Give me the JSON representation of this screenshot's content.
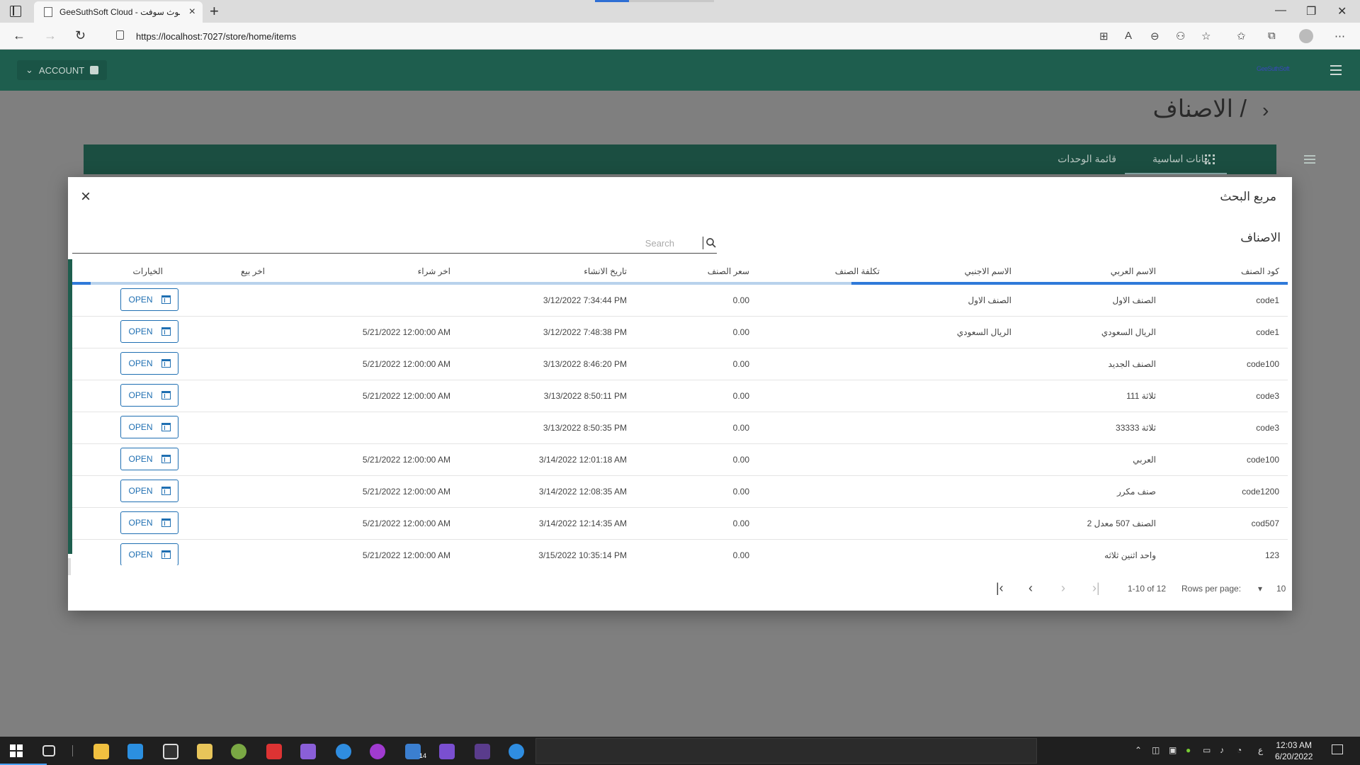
{
  "browser": {
    "tab_title": "GeeSuthSoft Cloud - جيسوث سوفت",
    "url": "https://localhost:7027/store/home/items"
  },
  "header": {
    "account_label": "ACCOUNT",
    "logo_text": "GeeSuthSoft"
  },
  "page": {
    "title": "/ الاصناف"
  },
  "tabs": [
    {
      "label": "بيانات اساسية"
    },
    {
      "label": "قائمة الوحدات"
    }
  ],
  "modal": {
    "title": "مربع البحث",
    "section_title": "الاصناف",
    "search_placeholder": "Search",
    "columns": {
      "code": "كود الصنف",
      "arabic_name": "الاسم العربي",
      "english_name": "الاسم الاجنبي",
      "cost": "تكلفة الصنف",
      "price": "سعر الصنف",
      "created": "تاريخ الانشاء",
      "last_buy": "اخر شراء",
      "last_sell": "اخر بيع",
      "options": "الخيارات"
    },
    "open_label": "OPEN",
    "rows": [
      {
        "code": "code1",
        "arabic_name": "الصنف الاول",
        "english_name": "الصنف الاول",
        "price": "0.00",
        "created": "3/12/2022 7:34:44 PM",
        "last_buy": ""
      },
      {
        "code": "code1",
        "arabic_name": "الريال السعودي",
        "english_name": "الريال السعودي",
        "price": "0.00",
        "created": "3/12/2022 7:48:38 PM",
        "last_buy": "5/21/2022 12:00:00 AM"
      },
      {
        "code": "code100",
        "arabic_name": "الصنف الجديد",
        "english_name": "",
        "price": "0.00",
        "created": "3/13/2022 8:46:20 PM",
        "last_buy": "5/21/2022 12:00:00 AM"
      },
      {
        "code": "code3",
        "arabic_name": "ثلاثة 111",
        "english_name": "",
        "price": "0.00",
        "created": "3/13/2022 8:50:11 PM",
        "last_buy": "5/21/2022 12:00:00 AM"
      },
      {
        "code": "code3",
        "arabic_name": "ثلاثة 33333",
        "english_name": "",
        "price": "0.00",
        "created": "3/13/2022 8:50:35 PM",
        "last_buy": ""
      },
      {
        "code": "code100",
        "arabic_name": "العربي",
        "english_name": "",
        "price": "0.00",
        "created": "3/14/2022 12:01:18 AM",
        "last_buy": "5/21/2022 12:00:00 AM"
      },
      {
        "code": "code1200",
        "arabic_name": "صنف مكرر",
        "english_name": "",
        "price": "0.00",
        "created": "3/14/2022 12:08:35 AM",
        "last_buy": "5/21/2022 12:00:00 AM"
      },
      {
        "code": "cod507",
        "arabic_name": "الصنف 507 معدل 2",
        "english_name": "",
        "price": "0.00",
        "created": "3/14/2022 12:14:35 AM",
        "last_buy": "5/21/2022 12:00:00 AM"
      },
      {
        "code": "123",
        "arabic_name": "واحد اثنين ثلاثه",
        "english_name": "",
        "price": "0.00",
        "created": "3/15/2022 10:35:14 PM",
        "last_buy": "5/21/2022 12:00:00 AM"
      },
      {
        "code": "",
        "arabic_name": "",
        "english_name": "",
        "price": "",
        "created": "",
        "last_buy": ""
      }
    ],
    "pager": {
      "rows_per_page_label": "Rows per page:",
      "rows_per_page_value": "10",
      "range_text": "1-10 of 12"
    }
  },
  "taskbar": {
    "time": "12:03 AM",
    "date": "6/20/2022",
    "badge": "14",
    "lang": "ع"
  },
  "colors": {
    "header_bg": "#1e5e4e",
    "accent_blue": "#1f6fb2",
    "overlay": "#7f7f7f"
  }
}
